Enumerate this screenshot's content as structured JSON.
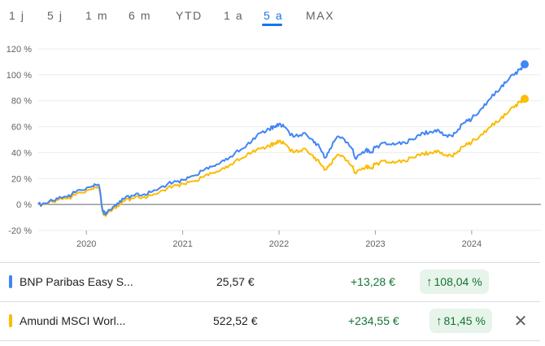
{
  "range_tabs": [
    {
      "label": "1 j",
      "active": false
    },
    {
      "label": "5 j",
      "active": false
    },
    {
      "label": "1 m",
      "active": false
    },
    {
      "label": "6 m",
      "active": false
    },
    {
      "label": "YTD",
      "active": false
    },
    {
      "label": "1 a",
      "active": false
    },
    {
      "label": "5 a",
      "active": true
    },
    {
      "label": "MAX",
      "active": false
    }
  ],
  "chart_data": {
    "type": "line",
    "x_ticks": [
      "2020",
      "2021",
      "2022",
      "2023",
      "2024"
    ],
    "y_ticks": [
      "120 %",
      "100 %",
      "80 %",
      "60 %",
      "40 %",
      "20 %",
      "0 %",
      "-20 %"
    ],
    "ylim": [
      -20,
      120
    ],
    "xlim": [
      2019.5,
      2024.55
    ],
    "grid": true,
    "series": [
      {
        "name": "BNP Paribas Easy S...",
        "color": "#4285f4",
        "points": [
          [
            2019.5,
            0
          ],
          [
            2019.58,
            1
          ],
          [
            2019.66,
            3
          ],
          [
            2019.75,
            5
          ],
          [
            2019.85,
            8
          ],
          [
            2019.95,
            11
          ],
          [
            2020.06,
            14
          ],
          [
            2020.13,
            15
          ],
          [
            2020.17,
            -5
          ],
          [
            2020.2,
            -8
          ],
          [
            2020.25,
            -4
          ],
          [
            2020.32,
            1
          ],
          [
            2020.4,
            5
          ],
          [
            2020.5,
            7
          ],
          [
            2020.6,
            8
          ],
          [
            2020.7,
            11
          ],
          [
            2020.8,
            14
          ],
          [
            2020.9,
            17
          ],
          [
            2021.0,
            19
          ],
          [
            2021.1,
            22
          ],
          [
            2021.2,
            26
          ],
          [
            2021.3,
            29
          ],
          [
            2021.4,
            33
          ],
          [
            2021.5,
            37
          ],
          [
            2021.6,
            42
          ],
          [
            2021.7,
            47
          ],
          [
            2021.8,
            55
          ],
          [
            2021.9,
            58
          ],
          [
            2021.95,
            60
          ],
          [
            2022.0,
            62
          ],
          [
            2022.05,
            60
          ],
          [
            2022.15,
            52
          ],
          [
            2022.25,
            55
          ],
          [
            2022.35,
            50
          ],
          [
            2022.42,
            44
          ],
          [
            2022.48,
            36
          ],
          [
            2022.55,
            45
          ],
          [
            2022.6,
            52
          ],
          [
            2022.68,
            50
          ],
          [
            2022.75,
            44
          ],
          [
            2022.8,
            35
          ],
          [
            2022.9,
            42
          ],
          [
            2022.95,
            40
          ],
          [
            2023.0,
            44
          ],
          [
            2023.1,
            48
          ],
          [
            2023.2,
            46
          ],
          [
            2023.3,
            48
          ],
          [
            2023.4,
            50
          ],
          [
            2023.5,
            55
          ],
          [
            2023.58,
            56
          ],
          [
            2023.66,
            57
          ],
          [
            2023.75,
            52
          ],
          [
            2023.83,
            55
          ],
          [
            2023.92,
            63
          ],
          [
            2024.0,
            66
          ],
          [
            2024.1,
            74
          ],
          [
            2024.2,
            82
          ],
          [
            2024.3,
            90
          ],
          [
            2024.38,
            96
          ],
          [
            2024.45,
            101
          ],
          [
            2024.5,
            104
          ],
          [
            2024.55,
            108.04
          ]
        ]
      },
      {
        "name": "Amundi MSCI Worl...",
        "color": "#fbbc04",
        "points": [
          [
            2019.5,
            0
          ],
          [
            2019.58,
            0.5
          ],
          [
            2019.66,
            2
          ],
          [
            2019.75,
            4
          ],
          [
            2019.85,
            6
          ],
          [
            2019.95,
            9
          ],
          [
            2020.06,
            12
          ],
          [
            2020.13,
            13
          ],
          [
            2020.17,
            -6
          ],
          [
            2020.2,
            -9
          ],
          [
            2020.25,
            -5
          ],
          [
            2020.32,
            -1
          ],
          [
            2020.4,
            3
          ],
          [
            2020.5,
            5
          ],
          [
            2020.6,
            6
          ],
          [
            2020.7,
            8
          ],
          [
            2020.8,
            11
          ],
          [
            2020.9,
            14
          ],
          [
            2021.0,
            16
          ],
          [
            2021.1,
            18
          ],
          [
            2021.2,
            21
          ],
          [
            2021.3,
            24
          ],
          [
            2021.4,
            27
          ],
          [
            2021.5,
            31
          ],
          [
            2021.6,
            35
          ],
          [
            2021.7,
            39
          ],
          [
            2021.8,
            43
          ],
          [
            2021.9,
            45
          ],
          [
            2021.95,
            47
          ],
          [
            2022.0,
            49
          ],
          [
            2022.05,
            47
          ],
          [
            2022.15,
            40
          ],
          [
            2022.25,
            43
          ],
          [
            2022.35,
            38
          ],
          [
            2022.42,
            32
          ],
          [
            2022.48,
            27
          ],
          [
            2022.55,
            32
          ],
          [
            2022.6,
            38
          ],
          [
            2022.68,
            36
          ],
          [
            2022.75,
            30
          ],
          [
            2022.8,
            24
          ],
          [
            2022.9,
            29
          ],
          [
            2022.95,
            28
          ],
          [
            2023.0,
            31
          ],
          [
            2023.1,
            34
          ],
          [
            2023.2,
            32
          ],
          [
            2023.3,
            34
          ],
          [
            2023.4,
            36
          ],
          [
            2023.5,
            39
          ],
          [
            2023.58,
            40
          ],
          [
            2023.66,
            41
          ],
          [
            2023.75,
            37
          ],
          [
            2023.83,
            39
          ],
          [
            2023.92,
            45
          ],
          [
            2024.0,
            48
          ],
          [
            2024.1,
            54
          ],
          [
            2024.2,
            60
          ],
          [
            2024.3,
            66
          ],
          [
            2024.38,
            71
          ],
          [
            2024.45,
            76
          ],
          [
            2024.5,
            79
          ],
          [
            2024.55,
            81.45
          ]
        ]
      }
    ]
  },
  "holdings": [
    {
      "name": "BNP Paribas Easy S...",
      "color": "#4285f4",
      "price": "25,57 €",
      "change": "+13,28 €",
      "arrow": "↑",
      "pct": "108,04 %",
      "closable": false
    },
    {
      "name": "Amundi MSCI Worl...",
      "color": "#fbbc04",
      "price": "522,52 €",
      "change": "+234,55 €",
      "arrow": "↑",
      "pct": "81,45 %",
      "closable": true
    }
  ],
  "close_glyph": "✕"
}
